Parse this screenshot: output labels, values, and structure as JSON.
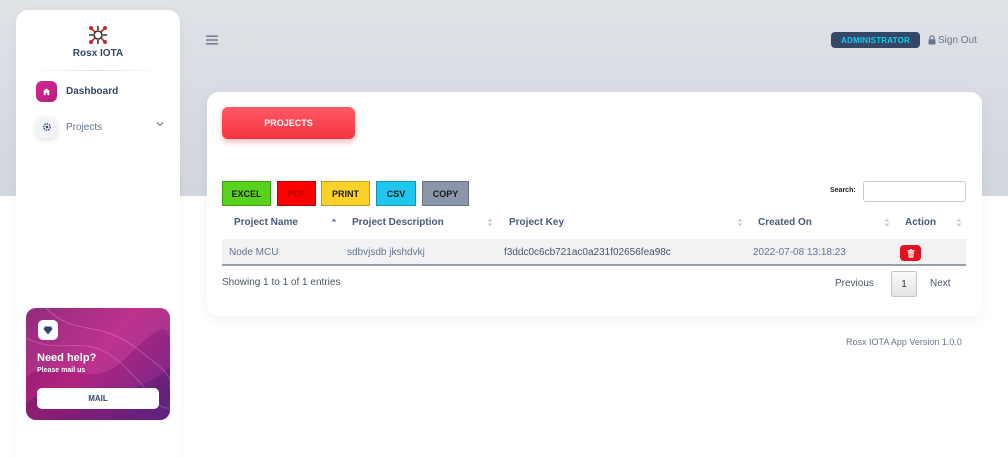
{
  "brand": {
    "name": "Rosx IOTA"
  },
  "sidebar": {
    "items": [
      {
        "label": "Dashboard",
        "icon": "home-icon",
        "active": true
      },
      {
        "label": "Projects",
        "icon": "gear-icon",
        "active": false
      }
    ],
    "help": {
      "title": "Need help?",
      "subtitle": "Please mail us",
      "button": "MAIL",
      "icon": "diamond-icon"
    }
  },
  "navbar": {
    "role_badge": "ADMINISTRATOR",
    "signout": "Sign Out"
  },
  "card": {
    "title_button": "PROJECTS",
    "export_buttons": [
      {
        "label": "EXCEL",
        "color": "#58d21a"
      },
      {
        "label": "PDF",
        "color": "#ff0000"
      },
      {
        "label": "PRINT",
        "color": "#fcd12a"
      },
      {
        "label": "CSV",
        "color": "#1ec7ee"
      },
      {
        "label": "COPY",
        "color": "#8a97aa"
      }
    ],
    "search_label": "Search:",
    "search_value": "",
    "table": {
      "columns": [
        "Project Name",
        "Project Description",
        "Project Key",
        "Created On",
        "Action"
      ],
      "rows": [
        {
          "name": "Node MCU",
          "description": "sdbvjsdb jkshdvkj",
          "key": "f3ddc0c6cb721ac0a231f02656fea98c",
          "created": "2022-07-08 13:18:23"
        }
      ]
    },
    "info": "Showing 1 to 1 of 1 entries",
    "pagination": {
      "previous": "Previous",
      "current": "1",
      "next": "Next"
    }
  },
  "footer": {
    "version": "Rosx IOTA App Version 1.0.0"
  },
  "colors": {
    "accent": "#f5333f",
    "active_nav": "#d42790",
    "badge_bg": "#344767",
    "badge_text": "#11cdef",
    "delete": "#e3121f"
  }
}
